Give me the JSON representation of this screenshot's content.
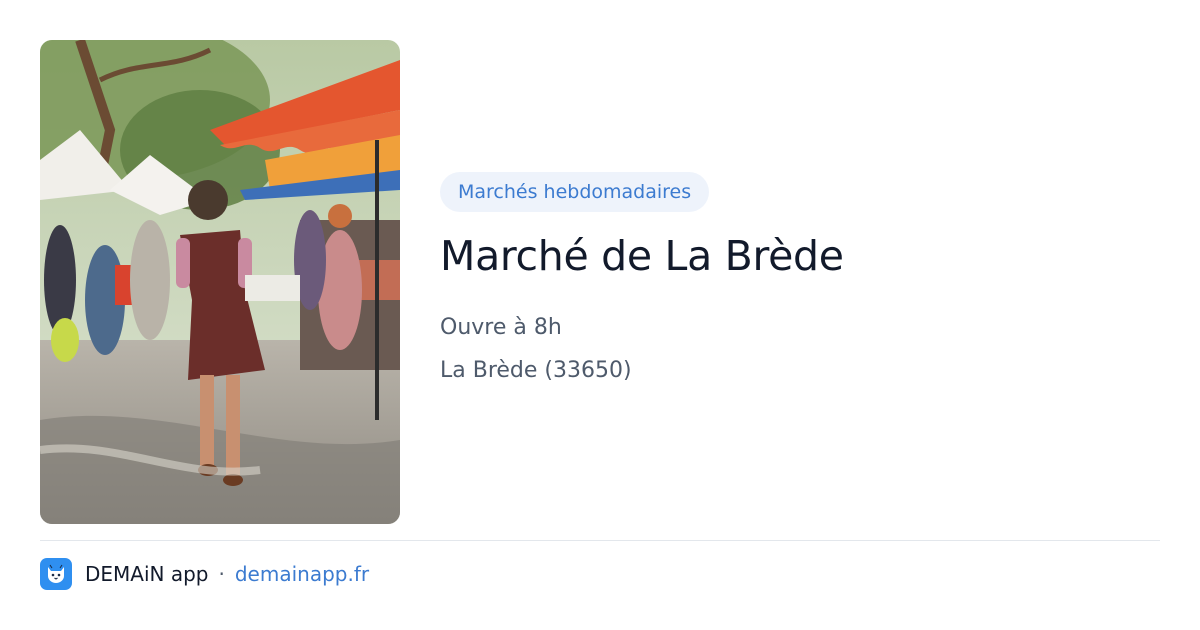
{
  "category": "Marchés hebdomadaires",
  "title": "Marché de La Brède",
  "opening": "Ouvre à 8h",
  "location": "La Brède (33650)",
  "footer": {
    "brand": "DEMAiN app",
    "separator": "·",
    "domain": "demainapp.fr",
    "logo_icon": "cat-face-icon"
  },
  "colors": {
    "accent": "#3c7bd0",
    "badge_bg": "#eef3fb",
    "title": "#121a2b",
    "muted": "#4e5a6b",
    "logo_bg": "#2f8ff0"
  }
}
